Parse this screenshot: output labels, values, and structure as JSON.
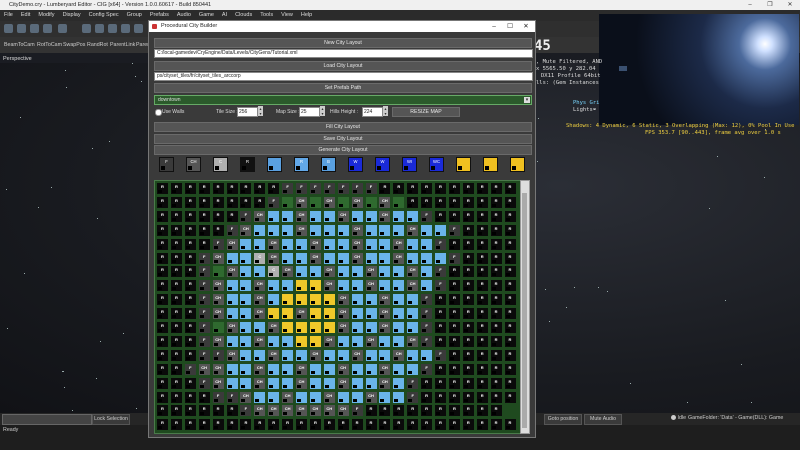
{
  "window": {
    "title": "CityDemo.cry - Lumberyard Editor - CIG [x64] - Version 1.0.0.60617 - Build 850441",
    "menu": [
      "File",
      "Edit",
      "Modify",
      "Display",
      "Config Spec",
      "Group",
      "Prefabs",
      "Audio",
      "Game",
      "AI",
      "Clouds",
      "Tools",
      "View",
      "Help"
    ]
  },
  "toolbar2": {
    "items": [
      "BeamToCam",
      "RotToCam",
      "SwapPos",
      "RandRot",
      "ParentLink",
      "Paren"
    ]
  },
  "viewport": {
    "label": "Perspective"
  },
  "overlay": {
    "digits": "45",
    "lines": [
      {
        "text": ", Mute Filtered, AND",
        "color": "#dddddd"
      },
      {
        "text": "x 5565.50   y 282.04",
        "color": "#dddddd"
      },
      {
        "text": "DX11 Profile 64bit",
        "color": "#dddddd"
      },
      {
        "text": "lls: (Gem Instances",
        "color": "#dddddd"
      },
      {
        "text": "Phys Gri",
        "color": "#7ad7ff"
      },
      {
        "text": "Lights=",
        "color": "#dddddd"
      },
      {
        "text": "Shadows:   4 Dynamic,   6 Static, 3 Overlapping (Max: 12), 0% Pool In Use",
        "color": "#f0d040"
      },
      {
        "text": "FPS 353.7 [90..443], frame avg over 1.0 s",
        "color": "#f0d040"
      }
    ]
  },
  "dialog": {
    "title": "Procedural City Builder",
    "new_layout": "New City Layout",
    "layout_path": "C:/local-gamedev/CryEngine/Data/Levels/CityGens/Tutorial.xml",
    "load_layout": "Load City Layout",
    "prefab_path": "ps/cityset_tiles/fr/cityset_tiles_arccorp",
    "set_prefab": "Set Prefab Path",
    "dropdown_value": "downtown",
    "use_walls": "Use Walls",
    "tile_size_label": "Tile Size :",
    "tile_size": "256",
    "map_size_label": "Map Size :",
    "map_size": "25",
    "hills_label": "Hills Height :",
    "hills_height": "224",
    "resize_map": "RESIZE MAP",
    "fill_layout": "Fill City Layout",
    "save_layout": "Save City Layout",
    "generate_layout": "Generate City Layout"
  },
  "palette": [
    {
      "label": "F",
      "color": "#3a3a3a"
    },
    {
      "label": "CH",
      "color": "#555555"
    },
    {
      "label": "C",
      "color": "#b0b0b0"
    },
    {
      "label": "R",
      "color": "#111111"
    },
    {
      "label": "",
      "color": "#5aa0e0"
    },
    {
      "label": "R",
      "color": "#62a8e8"
    },
    {
      "label": "B",
      "color": "#5aa0e0"
    },
    {
      "label": "W",
      "color": "#1a2ad8"
    },
    {
      "label": "W",
      "color": "#1a2ad8"
    },
    {
      "label": "WI",
      "color": "#1a2ad8"
    },
    {
      "label": "WC",
      "color": "#1a2ad8"
    },
    {
      "label": "",
      "color": "#f0c020"
    },
    {
      "label": "",
      "color": "#f0c020"
    },
    {
      "label": "",
      "color": "#f0c020"
    }
  ],
  "grid_types": {
    "R": {
      "label": "R",
      "color": "#0a0a0a"
    },
    "F": {
      "label": "F",
      "color": "#3a3a3a"
    },
    "CH": {
      "label": "CH",
      "color": "#555555"
    },
    "C": {
      "label": "C",
      "color": "#b0b0b0"
    },
    "B": {
      "label": "",
      "color": "#6ab4ea"
    },
    "Y": {
      "label": "",
      "color": "#f0c82a"
    },
    "G": {
      "label": "",
      "color": "#2f6a2f"
    }
  },
  "grid_rows": [
    "RRRRRRRRRFFFFFFFRRRRRRRRRRRRRRRR",
    "RRRRRRRRFGCHGCHGCHGCHGRRRRRRRRRR",
    "RRRRRRFCHBBCHBBCHBBCHBBFRRRRRRRR",
    "RRRRRFCHBBBCHBBBCHBBBCHBBFRRRRRR",
    "RRRRFCHBBCHBBCHBBCHBBCHBBFRRRRRR",
    "RRRFCHBBCCHBBCHBBCHBBCHBBBFRRRRR",
    "RRRFGCHBBCCHBBCHBBCHBBCHBFRRRRRR",
    "RRRFCHBBCHBBYYCHBBCHBBCHBFRRRRRR",
    "RRRFCHBBCHBYYYYCHBBCHBBFRRRRRRRR",
    "RRRFCHBBCHYYCHYYCHBBCHBBFRRRRRRR",
    "RRRFGCHBBCHYYYYCHBBCHBBFRRRRRRRR",
    "RRRFCHBBCHBBYYCHBBCHBBCHFRRRRRRR",
    "RRRFFCHBBCHBBCHBBCHBBCHBBFRRRRRR",
    "RRFCHCHBBCHBBCHBBCHBBCHBBFRRRRRR",
    "RRRFCHBBCHBBCHBBCHBBCHBFRRRRRRRR",
    "RRRRFFCHBBCHBBCHBBCHBBFRRRRRRRRR",
    "RRRRRRFCHCHCHCHCHCHCHFRRRRRRRRRR",
    "RRRRRRRRRRRRRRRRRRRRRRRRRRRRRRRR"
  ],
  "statusbar": {
    "ready": "Ready",
    "lock_selection": "Lock Selection",
    "goto_position": "Goto position",
    "mute_audio": "Mute Audio",
    "idle": "Idle",
    "game_folder": "GameFolder: 'Data' - Game(DLL): Game"
  }
}
